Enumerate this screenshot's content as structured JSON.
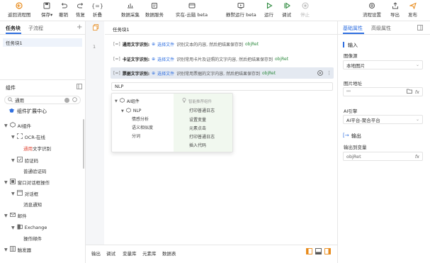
{
  "toolbar": {
    "buttons": [
      {
        "label": "返回流程图",
        "icon": "return-icon",
        "color": "#e88a1a"
      },
      {
        "label": "保存▾",
        "icon": "save-icon"
      },
      {
        "label": "撤销",
        "icon": "undo-icon"
      },
      {
        "label": "恢复",
        "icon": "redo-icon"
      },
      {
        "label": "折叠",
        "icon": "fold-icon"
      },
      {
        "label": "数据采集",
        "icon": "data-collect-icon"
      },
      {
        "label": "数据服务",
        "icon": "data-service-icon"
      },
      {
        "label": "实在-云脑 beta",
        "icon": "cloud-brain-icon"
      },
      {
        "label": "静默运行 beta",
        "icon": "silent-run-icon"
      },
      {
        "label": "运行",
        "icon": "run-icon",
        "color": "#2d8a3e"
      },
      {
        "label": "调试",
        "icon": "debug-icon",
        "color": "#2d8a3e"
      },
      {
        "label": "停止",
        "icon": "stop-icon"
      },
      {
        "label": "流程设置",
        "icon": "settings-icon"
      },
      {
        "label": "导出",
        "icon": "export-icon"
      },
      {
        "label": "发布",
        "icon": "publish-icon",
        "color": "#e88a1a"
      }
    ]
  },
  "left_top": {
    "tabs": [
      "任务块",
      "子流程"
    ],
    "add_symbol": "+",
    "items": [
      "任务块1"
    ]
  },
  "components": {
    "title": "组件",
    "search_value": "通用",
    "center_label": "组件扩展中心",
    "tree": [
      {
        "label": "AI组件",
        "level": 0,
        "expanded": true
      },
      {
        "label": "OCR-在线",
        "level": 1,
        "expanded": true
      },
      {
        "label_hl": "通用",
        "label_rest": "文字识别",
        "level": 2
      },
      {
        "label": "验证码",
        "level": 1,
        "expanded": true
      },
      {
        "label": "普通验证码",
        "level": 2
      },
      {
        "label": "窗口对话框操作",
        "level": 0,
        "expanded": true
      },
      {
        "label": "对话框",
        "level": 1,
        "expanded": true
      },
      {
        "label": "消息通知",
        "level": 2
      },
      {
        "label": "邮件",
        "level": 0,
        "expanded": true
      },
      {
        "label": "Exchange",
        "level": 1,
        "expanded": true
      },
      {
        "label": "操作邮件",
        "level": 2
      },
      {
        "label": "触发器",
        "level": 0,
        "expanded": true
      }
    ]
  },
  "canvas": {
    "tab": "任务块1",
    "line_number": "1",
    "steps": [
      {
        "title": "通用文字识别:",
        "action": "选择文件",
        "desc": "识别文本的内容, 然后把结果保存到",
        "var": "objRet"
      },
      {
        "title": "卡证文字识别:",
        "action": "选择文件",
        "desc": "识别常用卡片及证照的文字内容, 然后把结果保存到",
        "var": "objRet"
      },
      {
        "title": "票据文字识别:",
        "action": "选择文件",
        "desc": "识别常用票据的文字内容, 然后把结果保存到",
        "var": "objRet"
      }
    ],
    "input_value": "NLP",
    "popup": {
      "left_root": "AI组件",
      "left_child": "NLP",
      "left_items": [
        "情感分析",
        "语义相似度",
        "分词"
      ],
      "right_header": "智能推荐组件",
      "right_items": [
        "打印普通日志",
        "设置变量",
        "元素点击",
        "打印普通日志",
        "插入代码"
      ]
    },
    "bottom_tabs": [
      "输出",
      "调试",
      "变量库",
      "元素库",
      "数据表"
    ]
  },
  "right": {
    "tabs": [
      "基础属性",
      "高级属性"
    ],
    "input_section": "输入",
    "image_source_label": "图像源",
    "image_source_value": "本地图片",
    "image_path_label": "图片地址",
    "image_path_value": "\"\"",
    "fx": "fx",
    "ai_engine_label": "AI引擎",
    "ai_engine_value": "AI平台-聚合平台",
    "output_section": "输出",
    "output_var_label": "输出到变量",
    "output_var_value": "objRet"
  }
}
